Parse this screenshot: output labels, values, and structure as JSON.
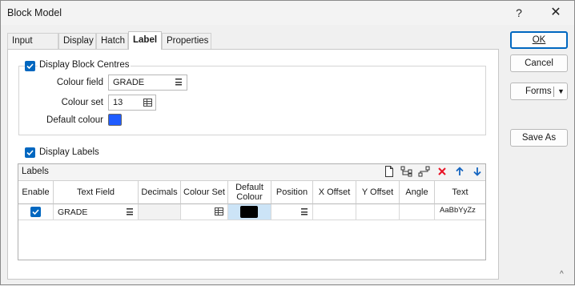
{
  "window": {
    "title": "Block Model",
    "help_glyph": "?",
    "close_glyph": "✕"
  },
  "tabs": [
    {
      "label": "Input Data"
    },
    {
      "label": "Display"
    },
    {
      "label": "Hatch"
    },
    {
      "label": "Label",
      "active": true
    },
    {
      "label": "Properties"
    }
  ],
  "block_centres": {
    "label": "Display Block Centres",
    "checked": true,
    "colour_field_label": "Colour field",
    "colour_field_value": "GRADE",
    "colour_set_label": "Colour set",
    "colour_set_value": "13",
    "default_colour_label": "Default colour",
    "default_colour": "#1f5cff"
  },
  "display_labels": {
    "label": "Display Labels",
    "checked": true
  },
  "labels_grid": {
    "title": "Labels",
    "tools": [
      "new-file-icon",
      "tree-add-icon",
      "tree-insert-icon",
      "delete-icon",
      "move-up-icon",
      "move-down-icon"
    ],
    "columns": [
      "Enable",
      "Text Field",
      "Decimals",
      "Colour Set",
      "Default Colour",
      "Position",
      "X Offset",
      "Y Offset",
      "Angle",
      "Text"
    ],
    "rows": [
      {
        "enable": true,
        "text_field": "GRADE",
        "decimals": "",
        "colour_set": "",
        "default_colour": "#000000",
        "position": "",
        "x_offset": "",
        "y_offset": "",
        "angle": "",
        "text": "AaBbYyZz"
      }
    ]
  },
  "buttons": {
    "ok": "OK",
    "cancel": "Cancel",
    "forms": "Forms",
    "save_as": "Save As"
  },
  "colors": {
    "accent": "#0067c0",
    "selected_cell": "#cce4f7"
  }
}
